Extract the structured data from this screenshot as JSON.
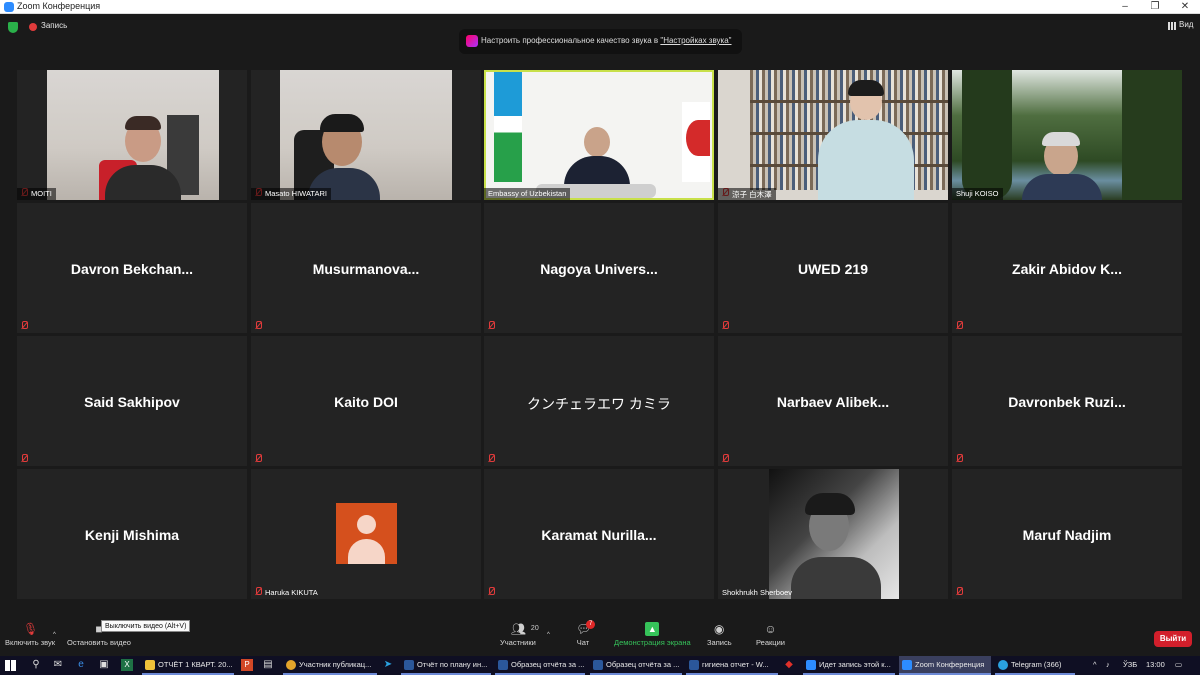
{
  "window": {
    "title": "Zoom Конференция",
    "controls": [
      "‒",
      "❐",
      "✕"
    ]
  },
  "topbar": {
    "recording_label": "Запись",
    "view_label": "Вид",
    "notice_text": "Настроить профессиональное качество звука в ",
    "notice_link": "\"Настройках звука\""
  },
  "participants": [
    {
      "name": "MOITI",
      "type": "video"
    },
    {
      "name": "Masato HIWATARI",
      "type": "video"
    },
    {
      "name": "Embassy of Uzbekistan",
      "type": "video",
      "active": true
    },
    {
      "name": "涼子 白木澤",
      "type": "video"
    },
    {
      "name": "Shuji KOISO",
      "type": "video"
    },
    {
      "name": "Davron  Bekchan...",
      "type": "name"
    },
    {
      "name": "Musurmanova...",
      "type": "name"
    },
    {
      "name": "Nagoya  Univers...",
      "type": "name"
    },
    {
      "name": "UWED 219",
      "type": "name"
    },
    {
      "name": "Zakir Abidov  K...",
      "type": "name"
    },
    {
      "name": "Said Sakhipov",
      "type": "name"
    },
    {
      "name": "Kaito DOI",
      "type": "name"
    },
    {
      "name": "クンチェラエワ カミラ",
      "type": "name"
    },
    {
      "name": "Narbaev  Alibek...",
      "type": "name"
    },
    {
      "name": "Davronbek  Ruzi...",
      "type": "name"
    },
    {
      "name": "Kenji Mishima",
      "type": "name"
    },
    {
      "name": "Haruka KIKUTA",
      "type": "avatar"
    },
    {
      "name": "Karamat  Nurilla...",
      "type": "name"
    },
    {
      "name": "Shokhrukh Sherboev",
      "type": "video"
    },
    {
      "name": "Maruf Nadjim",
      "type": "name"
    }
  ],
  "controls": {
    "unmute": "Включить звук",
    "stop_video": "Остановить видео",
    "tooltip": "Выключить видео (Alt+V)",
    "participants": "Участники",
    "participants_count": "20",
    "chat": "Чат",
    "chat_badge": "7",
    "share_screen": "Демонстрация экрана",
    "record": "Запись",
    "reactions": "Реакции",
    "leave": "Выйти"
  },
  "taskbar": {
    "apps": [
      "ОТЧЁТ 1 КВАРТ. 20...",
      "Участник публикац...",
      "Отчёт по плану ин...",
      "Образец отчёта за ...",
      "Образец отчёта за ...",
      "гигиена отчет - W...",
      "Идет запись этой к...",
      "Zoom Конференция",
      "Telegram (366)"
    ],
    "lang": "ЎЗБ",
    "time": "13:00"
  },
  "colors": {
    "accent_active": "#c8e04a",
    "leave_red": "#d21f2b",
    "share_green": "#36c35a",
    "avatar_orange": "#d5501d"
  }
}
